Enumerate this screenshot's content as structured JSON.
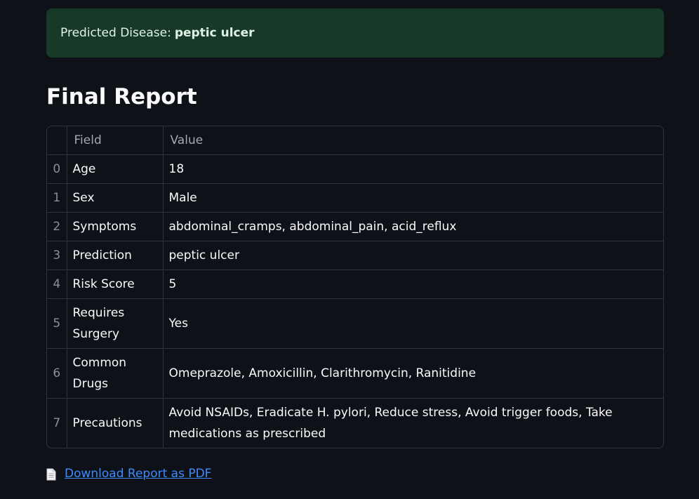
{
  "alert": {
    "label": "Predicted Disease:",
    "value": "peptic ulcer"
  },
  "report": {
    "title": "Final Report",
    "columns": [
      "",
      "Field",
      "Value"
    ],
    "rows": [
      {
        "index": "0",
        "field": "Age",
        "value": "18"
      },
      {
        "index": "1",
        "field": "Sex",
        "value": "Male"
      },
      {
        "index": "2",
        "field": "Symptoms",
        "value": "abdominal_cramps, abdominal_pain, acid_reflux"
      },
      {
        "index": "3",
        "field": "Prediction",
        "value": "peptic ulcer"
      },
      {
        "index": "4",
        "field": "Risk Score",
        "value": "5"
      },
      {
        "index": "5",
        "field": "Requires Surgery",
        "value": "Yes"
      },
      {
        "index": "6",
        "field": "Common Drugs",
        "value": "Omeprazole, Amoxicillin, Clarithromycin, Ranitidine"
      },
      {
        "index": "7",
        "field": "Precautions",
        "value": "Avoid NSAIDs, Eradicate H. pylori, Reduce stress, Avoid trigger foods, Take medications as prescribed"
      }
    ]
  },
  "download": {
    "icon": "document-icon",
    "label": "Download Report as PDF"
  },
  "colors": {
    "background": "#0e1117",
    "alert_bg": "#173928",
    "link": "#3d8bfd"
  }
}
